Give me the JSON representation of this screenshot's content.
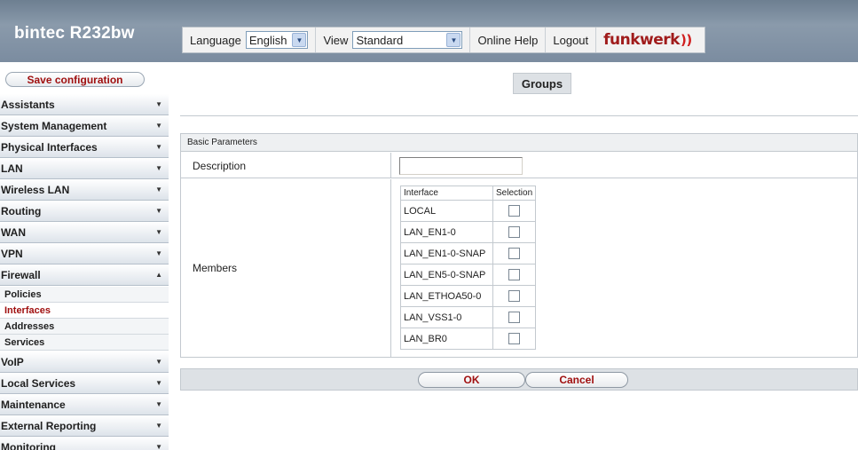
{
  "header": {
    "brand": "bintec R232bw",
    "language_label": "Language",
    "language_value": "English",
    "view_label": "View",
    "view_value": "Standard",
    "online_help": "Online Help",
    "logout": "Logout",
    "logo_text": "funkwerk"
  },
  "sidebar": {
    "save_label": "Save configuration",
    "items": [
      {
        "label": "Assistants",
        "chev": "▼"
      },
      {
        "label": "System Management",
        "chev": "▼"
      },
      {
        "label": "Physical Interfaces",
        "chev": "▼"
      },
      {
        "label": "LAN",
        "chev": "▼"
      },
      {
        "label": "Wireless LAN",
        "chev": "▼"
      },
      {
        "label": "Routing",
        "chev": "▼"
      },
      {
        "label": "WAN",
        "chev": "▼"
      },
      {
        "label": "VPN",
        "chev": "▼"
      },
      {
        "label": "Firewall",
        "chev": "▲"
      },
      {
        "label": "VoIP",
        "chev": "▼"
      },
      {
        "label": "Local Services",
        "chev": "▼"
      },
      {
        "label": "Maintenance",
        "chev": "▼"
      },
      {
        "label": "External Reporting",
        "chev": "▼"
      },
      {
        "label": "Monitoring",
        "chev": "▼"
      }
    ],
    "firewall_sub": [
      {
        "label": "Policies"
      },
      {
        "label": "Interfaces",
        "active": true
      },
      {
        "label": "Addresses"
      },
      {
        "label": "Services"
      }
    ]
  },
  "main": {
    "tab": "Groups",
    "section_title": "Basic Parameters",
    "description_label": "Description",
    "description_value": "",
    "members_label": "Members",
    "table_headers": [
      "Interface",
      "Selection"
    ],
    "interfaces": [
      "LOCAL",
      "LAN_EN1-0",
      "LAN_EN1-0-SNAP",
      "LAN_EN5-0-SNAP",
      "LAN_ETHOA50-0",
      "LAN_VSS1-0",
      "LAN_BR0"
    ],
    "ok_label": "OK",
    "cancel_label": "Cancel"
  }
}
